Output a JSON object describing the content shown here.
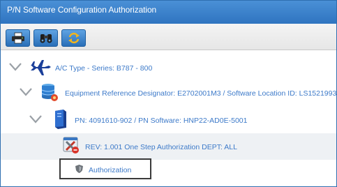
{
  "window": {
    "title": "P/N Software Configuration Authorization"
  },
  "toolbar": {
    "buttons": [
      {
        "icon": "printer-icon"
      },
      {
        "icon": "binoculars-icon"
      },
      {
        "icon": "refresh-icon"
      }
    ]
  },
  "tree": {
    "nodes": [
      {
        "label": "A/C Type - Series: B787 - 800",
        "icon": "airplane-icon"
      },
      {
        "label": "Equipment Reference Designator: E2702001M3 / Software Location ID: LS1521993",
        "icon": "database-icon"
      },
      {
        "label": "PN: 4091610-902 / PN Software: HNP22-AD0E-5001",
        "icon": "device-icon"
      },
      {
        "label": "REV: 1.001 One Step Authorization DEPT: ALL",
        "icon": "tools-icon"
      }
    ],
    "authorization": {
      "label": "Authorization",
      "icon": "shield-icon"
    }
  },
  "colors": {
    "title_bar": "#3a80c9",
    "link_text": "#3d7ac9",
    "selected_row": "#eef1f4"
  }
}
